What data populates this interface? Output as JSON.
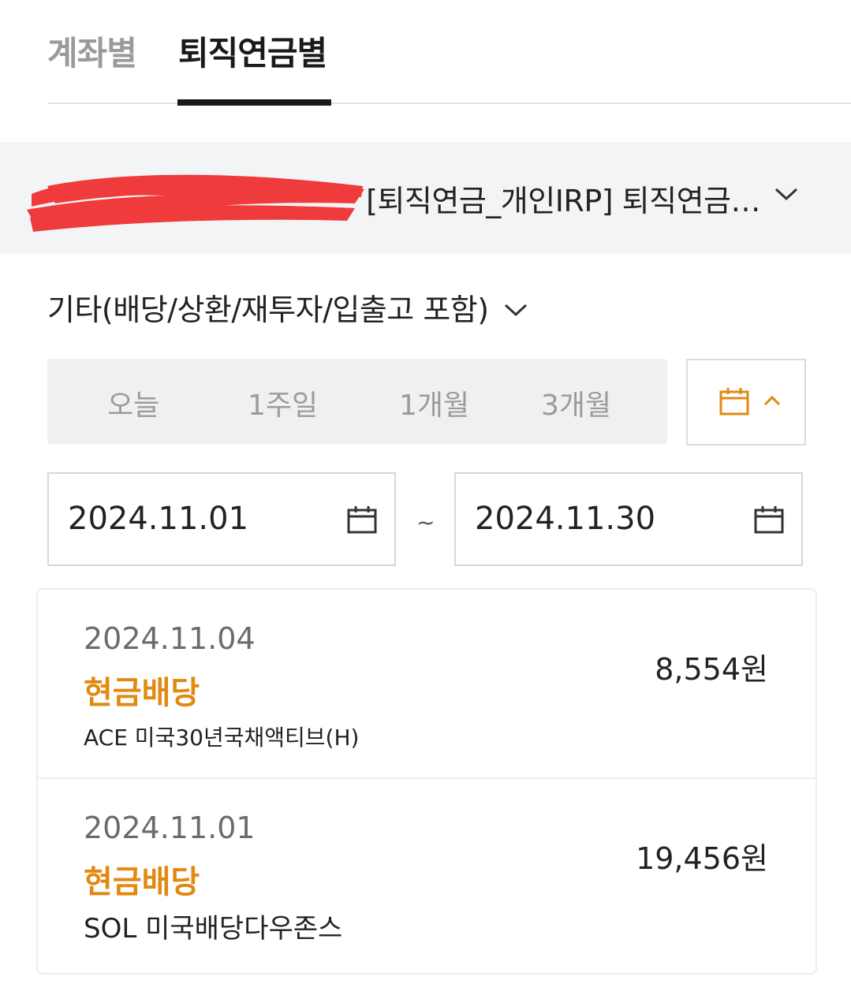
{
  "tabs": [
    {
      "label": "계좌별",
      "active": false
    },
    {
      "label": "퇴직연금별",
      "active": true
    }
  ],
  "account": {
    "label": "[퇴직연금_개인IRP] 퇴직연금…"
  },
  "filter": {
    "label": "기타(배당/상환/재투자/입출고 포함)"
  },
  "periods": [
    "오늘",
    "1주일",
    "1개월",
    "3개월"
  ],
  "date_range": {
    "start": "2024.11.01",
    "separator": "~",
    "end": "2024.11.30"
  },
  "transactions": [
    {
      "date": "2024.11.04",
      "type": "현금배당",
      "name": "ACE 미국30년국채액티브(H)",
      "amount": "8,554원"
    },
    {
      "date": "2024.11.01",
      "type": "현금배당",
      "name": "SOL 미국배당다우존스",
      "amount": "19,456원"
    }
  ],
  "colors": {
    "accent": "#e08a12",
    "active_tab": "#1a1a1a",
    "inactive_tab": "#9a9a9a",
    "redaction": "#ef3b3b"
  },
  "icons": [
    "chevron-down-icon",
    "calendar-icon",
    "chevron-up-icon"
  ]
}
